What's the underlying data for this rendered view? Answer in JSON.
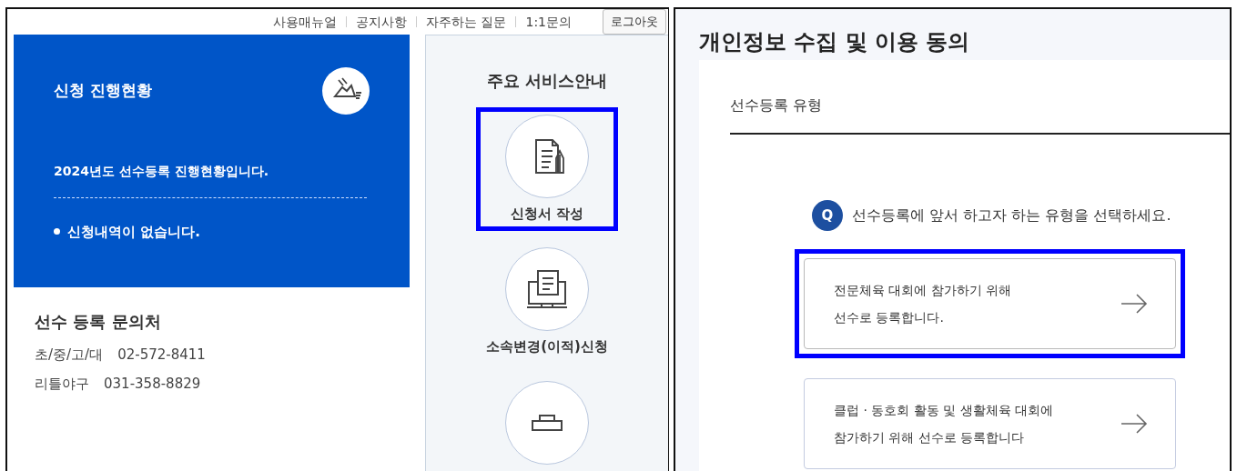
{
  "top_nav": {
    "links": [
      "사용매뉴얼",
      "공지사항",
      "자주하는 질문",
      "1:1문의"
    ],
    "logout_button": "로그아웃"
  },
  "status_card": {
    "title": "신청 진행현황",
    "subtitle": "2024년도 선수등록 진행현황입니다.",
    "items": [
      "신청내역이 없습니다."
    ]
  },
  "contact": {
    "title": "선수 등록 문의처",
    "rows": [
      {
        "label": "초/중/고/대",
        "phone": "02-572-8411"
      },
      {
        "label": "리틀야구",
        "phone": "031-358-8829"
      }
    ]
  },
  "services": {
    "title": "주요 서비스안내",
    "items": [
      {
        "kind": "document",
        "label": "신청서 작성",
        "highlighted": true
      },
      {
        "kind": "monitor",
        "label": "소속변경(이적)신청",
        "highlighted": false
      },
      {
        "kind": "briefcase",
        "highlighted": false
      }
    ]
  },
  "consent": {
    "title": "개인정보 수집 및 이용 동의",
    "section": "선수등록 유형",
    "question_mark": "Q",
    "question": "선수등록에 앞서 하고자 하는 유형을 선택하세요.",
    "options": [
      {
        "lines": [
          "전문체육 대회에 참가하기 위해",
          "선수로 등록합니다."
        ],
        "highlighted": true
      },
      {
        "lines": [
          "클럽 · 동호회 활동 및 생활체육 대회에",
          "참가하기 위해 선수로 등록합니다"
        ],
        "highlighted": false
      }
    ]
  }
}
